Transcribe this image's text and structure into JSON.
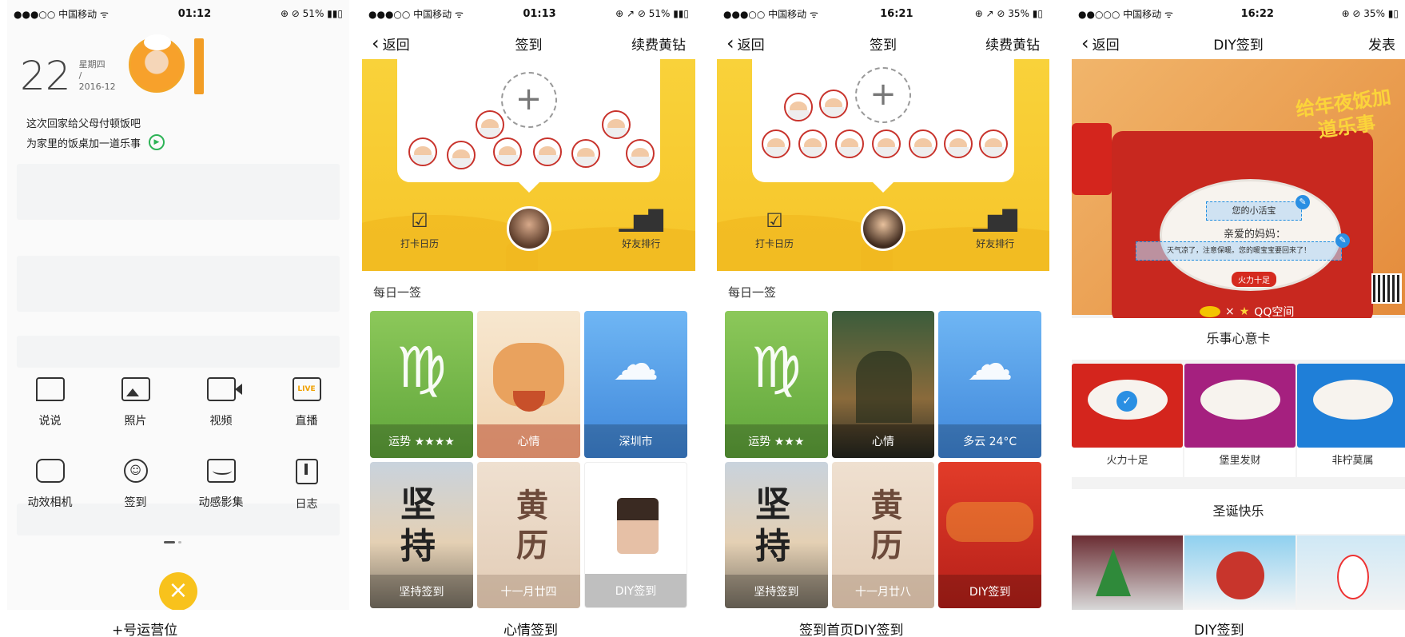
{
  "captions": [
    "+号运营位",
    "心情签到",
    "签到首页DIY签到",
    "DIY签到"
  ],
  "screen1": {
    "status": {
      "carrier": "●●●○○ 中国移动 ᯤ",
      "time": "01:12",
      "right": "⊕ ⊘ 51% ▮▮▯"
    },
    "date_day": "22",
    "date_week": "星期四",
    "date_sep": "/",
    "date_month": "2016-12",
    "banner_line1": "这次回家给父母付顿饭吧",
    "banner_line2": "为家里的饭桌加一道乐事",
    "row1": [
      {
        "label": "说说",
        "icon": "chat-icon"
      },
      {
        "label": "照片",
        "icon": "image-icon"
      },
      {
        "label": "视频",
        "icon": "video-icon"
      },
      {
        "label": "直播",
        "icon": "live-icon"
      }
    ],
    "row2": [
      {
        "label": "动效相机",
        "icon": "camera-icon"
      },
      {
        "label": "签到",
        "icon": "checkin-icon"
      },
      {
        "label": "动感影集",
        "icon": "album-icon"
      },
      {
        "label": "日志",
        "icon": "diary-icon"
      }
    ],
    "fab_label": "×"
  },
  "screen2": {
    "status": {
      "carrier": "●●●○○ 中国移动 ᯤ",
      "time": "01:13",
      "right": "⊕ ↗ ⊘ 51% ▮▮▯"
    },
    "nav": {
      "back": "返回",
      "title": "签到",
      "action": "续费黄钻"
    },
    "btn_calendar": "打卡日历",
    "btn_rank": "好友排行",
    "section": "每日一签",
    "tiles": [
      "运势 ★★★★",
      "心情",
      "深圳市",
      "坚持签到",
      "十一月廿四",
      "DIY签到"
    ],
    "tile_texts": {
      "jianchi": "坚持",
      "huangli": "黄历"
    }
  },
  "screen3": {
    "status": {
      "carrier": "●●●○○ 中国移动 ᯤ",
      "time": "16:21",
      "right": "⊕ ↗ ⊘ 35% ▮▯"
    },
    "nav": {
      "back": "返回",
      "title": "签到",
      "action": "续费黄钻"
    },
    "btn_calendar": "打卡日历",
    "btn_rank": "好友排行",
    "section": "每日一签",
    "tiles": [
      "运势 ★★★",
      "心情",
      "多云 24°C",
      "坚持签到",
      "十一月廿八",
      "DIY签到"
    ],
    "tile_texts": {
      "jianchi": "坚持",
      "huangli": "黄历"
    }
  },
  "screen4": {
    "status": {
      "carrier": "●●○○○ 中国移动 ᯤ",
      "time": "16:22",
      "right": "⊕ ⊘ 35% ▮▯"
    },
    "nav": {
      "back": "返回",
      "title": "DIY签到",
      "action": "发表"
    },
    "calligraphy": "给年夜饭加道乐事",
    "fish_line1": "您的小活宝",
    "fish_line2": "亲爱的妈妈：",
    "fish_line3": "天气凉了，注意保暖。您的暖宝宝要回来了！",
    "stamp": "火力十足",
    "brand": "QQ空间",
    "section1": "乐事心意卡",
    "cards": [
      "火力十足",
      "堡里发财",
      "非柠莫属"
    ],
    "section2": "圣诞快乐"
  }
}
